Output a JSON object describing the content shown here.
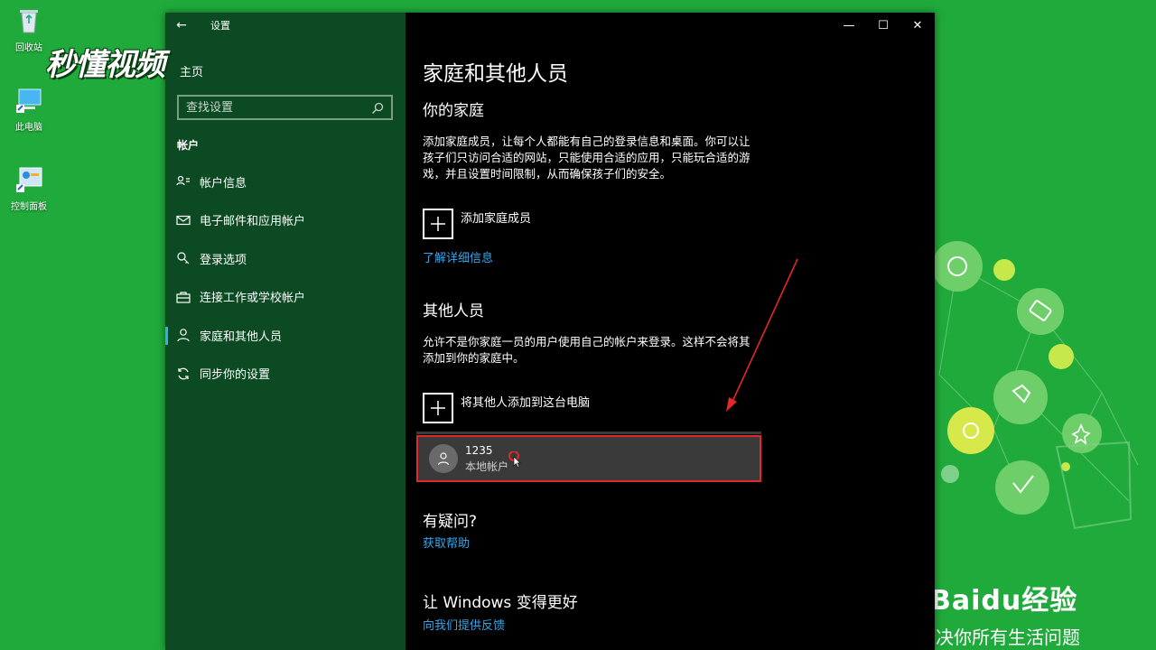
{
  "desktop": {
    "icons": [
      {
        "label": "回收站",
        "icon": "recycle-bin-icon"
      },
      {
        "label": "此电脑",
        "icon": "computer-icon"
      },
      {
        "label": "控制面板",
        "icon": "control-panel-icon"
      }
    ],
    "watermark": "秒懂视频",
    "baidu_brand": "Baidu经验",
    "baidu_slogan": "决你所有生活问题"
  },
  "window": {
    "title": "设置",
    "controls": {
      "minimize": "—",
      "maximize": "☐",
      "close": "✕"
    }
  },
  "sidebar": {
    "home_label": "主页",
    "search_placeholder": "查找设置",
    "section_title": "帐户",
    "items": [
      {
        "label": "帐户信息",
        "icon": "account-info-icon",
        "active": false
      },
      {
        "label": "电子邮件和应用帐户",
        "icon": "mail-icon",
        "active": false
      },
      {
        "label": "登录选项",
        "icon": "key-icon",
        "active": false
      },
      {
        "label": "连接工作或学校帐户",
        "icon": "briefcase-icon",
        "active": false
      },
      {
        "label": "家庭和其他人员",
        "icon": "person-icon",
        "active": true
      },
      {
        "label": "同步你的设置",
        "icon": "sync-icon",
        "active": false
      }
    ]
  },
  "main": {
    "page_title": "家庭和其他人员",
    "family": {
      "heading": "你的家庭",
      "description": "添加家庭成员，让每个人都能有自己的登录信息和桌面。你可以让孩子们只访问合适的网站，只能使用合适的应用，只能玩合适的游戏，并且设置时间限制，从而确保孩子们的安全。",
      "add_label": "添加家庭成员",
      "learn_more": "了解详细信息"
    },
    "others": {
      "heading": "其他人员",
      "description": "允许不是你家庭一员的用户使用自己的帐户来登录。这样不会将其添加到你的家庭中。",
      "add_label": "将其他人添加到这台电脑",
      "users": [
        {
          "name": "1235",
          "type": "本地帐户"
        }
      ]
    },
    "help": {
      "heading": "有疑问?",
      "link": "获取帮助"
    },
    "feedback": {
      "heading": "让 Windows 变得更好",
      "link": "向我们提供反馈"
    }
  },
  "colors": {
    "desktop_green": "#1faa3b",
    "sidebar_green": "#0b4a22",
    "link_blue": "#35a6e8",
    "highlight_red": "#e0282b",
    "active_marker": "#2fb0e8"
  }
}
